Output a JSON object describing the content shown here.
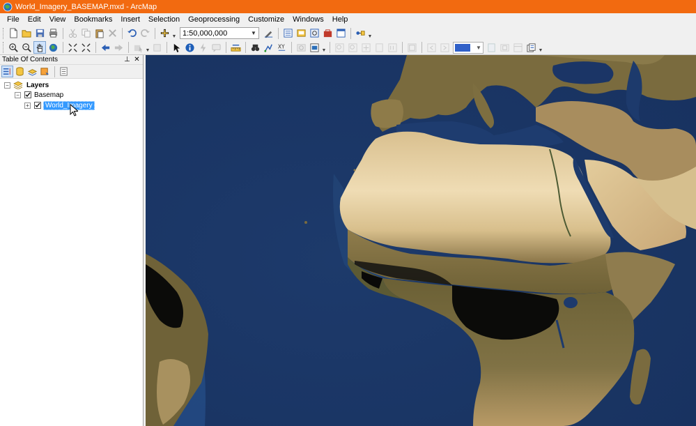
{
  "window": {
    "title": "World_Imagery_BASEMAP.mxd - ArcMap",
    "app_icon": "globe-icon",
    "title_color": "#f26a10"
  },
  "menu": [
    "File",
    "Edit",
    "View",
    "Bookmarks",
    "Insert",
    "Selection",
    "Geoprocessing",
    "Customize",
    "Windows",
    "Help"
  ],
  "standard_toolbar": {
    "scale_value": "1:50,000,000"
  },
  "toc": {
    "title": "Table Of Contents",
    "pin_icon": "pin-icon",
    "close_icon": "close-icon",
    "tree": {
      "root_label": "Layers",
      "group_label": "Basemap",
      "layer_label": "World_Imagery",
      "layer_checked": true,
      "group_checked": true
    }
  },
  "map": {
    "content": "world-imagery-basemap",
    "colors": {
      "ocean_deep": "#1b3768",
      "ocean_shelf": "#2e5f95",
      "desert": "#e6d2a4",
      "savanna": "#7d6f43",
      "forest": "#0a0a08"
    }
  }
}
